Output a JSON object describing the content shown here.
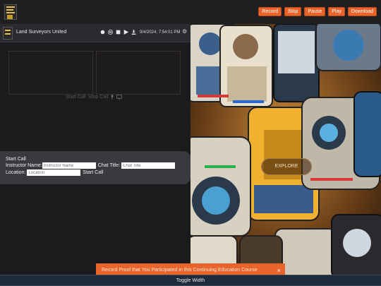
{
  "header": {
    "buttons": {
      "record": "Record",
      "stop": "Stop",
      "pause": "Pause",
      "play": "Play",
      "download": "Download"
    }
  },
  "callbar": {
    "org_name": "Land Surveyors United",
    "datetime": "9/4/2024, 7:54:01 PM",
    "controls": [
      "record-dot-icon",
      "pause-icon",
      "stop-icon",
      "play-icon",
      "download-icon"
    ]
  },
  "call_links": {
    "start": "Start Call",
    "stop": "Stop Call",
    "icons": [
      "microphone-icon",
      "monitor-icon"
    ]
  },
  "start_panel": {
    "title": "Start Call",
    "instructor_label": "Instructor Name:",
    "instructor_placeholder": "Instructor Name",
    "chat_label": "Chat Title:",
    "chat_placeholder": "Chat Title",
    "location_label": "Location:",
    "location_placeholder": "Location",
    "start_label": "Start Call"
  },
  "hero": {
    "explore": "EXPLORE"
  },
  "toast": {
    "message": "Record Proof that You Participated in this Continuing Education Course",
    "close": "×"
  },
  "footer": {
    "toggle": "Toggle Width"
  },
  "colors": {
    "accent": "#e8642b",
    "panel": "#3a3a3e",
    "background": "#1b1b1d"
  }
}
